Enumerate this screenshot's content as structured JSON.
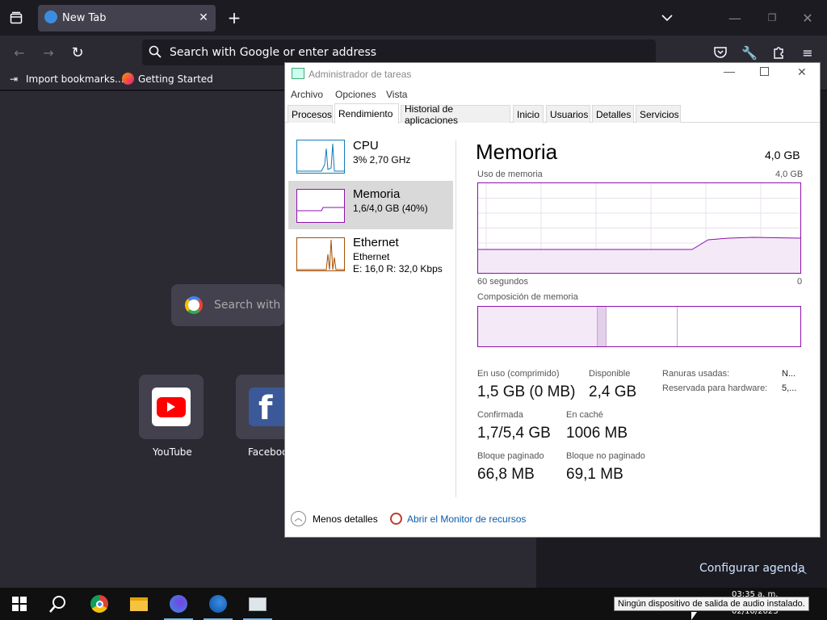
{
  "browser": {
    "tab_title": "New Tab",
    "url_placeholder": "Search with Google or enter address",
    "bookmarks": [
      "Import bookmarks...",
      "Getting Started"
    ],
    "search_placeholder": "Search with G",
    "shortcuts": [
      {
        "label": "YouTube"
      },
      {
        "label": "Faceboo"
      }
    ],
    "agenda": "Configurar agenda"
  },
  "taskmgr": {
    "title": "Administrador de tareas",
    "menus": [
      "Archivo",
      "Opciones",
      "Vista"
    ],
    "tabs": [
      "Procesos",
      "Rendimiento",
      "Historial de aplicaciones",
      "Inicio",
      "Usuarios",
      "Detalles",
      "Servicios"
    ],
    "sidebar": [
      {
        "name": "CPU",
        "sub1": "3% 2,70 GHz",
        "sub2": ""
      },
      {
        "name": "Memoria",
        "sub1": "1,6/4,0 GB (40%)",
        "sub2": ""
      },
      {
        "name": "Ethernet",
        "sub1": "Ethernet",
        "sub2": "E: 16,0 R: 32,0 Kbps"
      }
    ],
    "heading": "Memoria",
    "total": "4,0 GB",
    "usage_label": "Uso de memoria",
    "usage_max": "4,0 GB",
    "time_left": "60 segundos",
    "time_right": "0",
    "composition_label": "Composición de memoria",
    "stats": {
      "en_uso_label": "En uso (comprimido)",
      "en_uso": "1,5 GB (0 MB)",
      "disponible_label": "Disponible",
      "disponible": "2,4 GB",
      "confirmada_label": "Confirmada",
      "confirmada": "1,7/5,4 GB",
      "cache_label": "En caché",
      "cache": "1006 MB",
      "paginado_label": "Bloque paginado",
      "paginado": "66,8 MB",
      "nopaginado_label": "Bloque no paginado",
      "nopaginado": "69,1 MB",
      "ranuras_label": "Ranuras usadas:",
      "ranuras": "N...",
      "reservada_label": "Reservada para hardware:",
      "reservada": "5,..."
    },
    "fewer_details": "Menos detalles",
    "resource_monitor": "Abrir el Monitor de recursos"
  },
  "taskbar": {
    "tooltip": "Ningún dispositivo de salida de audio instalado.",
    "time": "03:35 a. m.",
    "date": "02/10/2023"
  },
  "colors": {
    "memory_purple": "#8b12ae",
    "cpu_blue": "#117dbb",
    "ethernet_orange": "#a74f01",
    "accent": "#76b9ed"
  }
}
